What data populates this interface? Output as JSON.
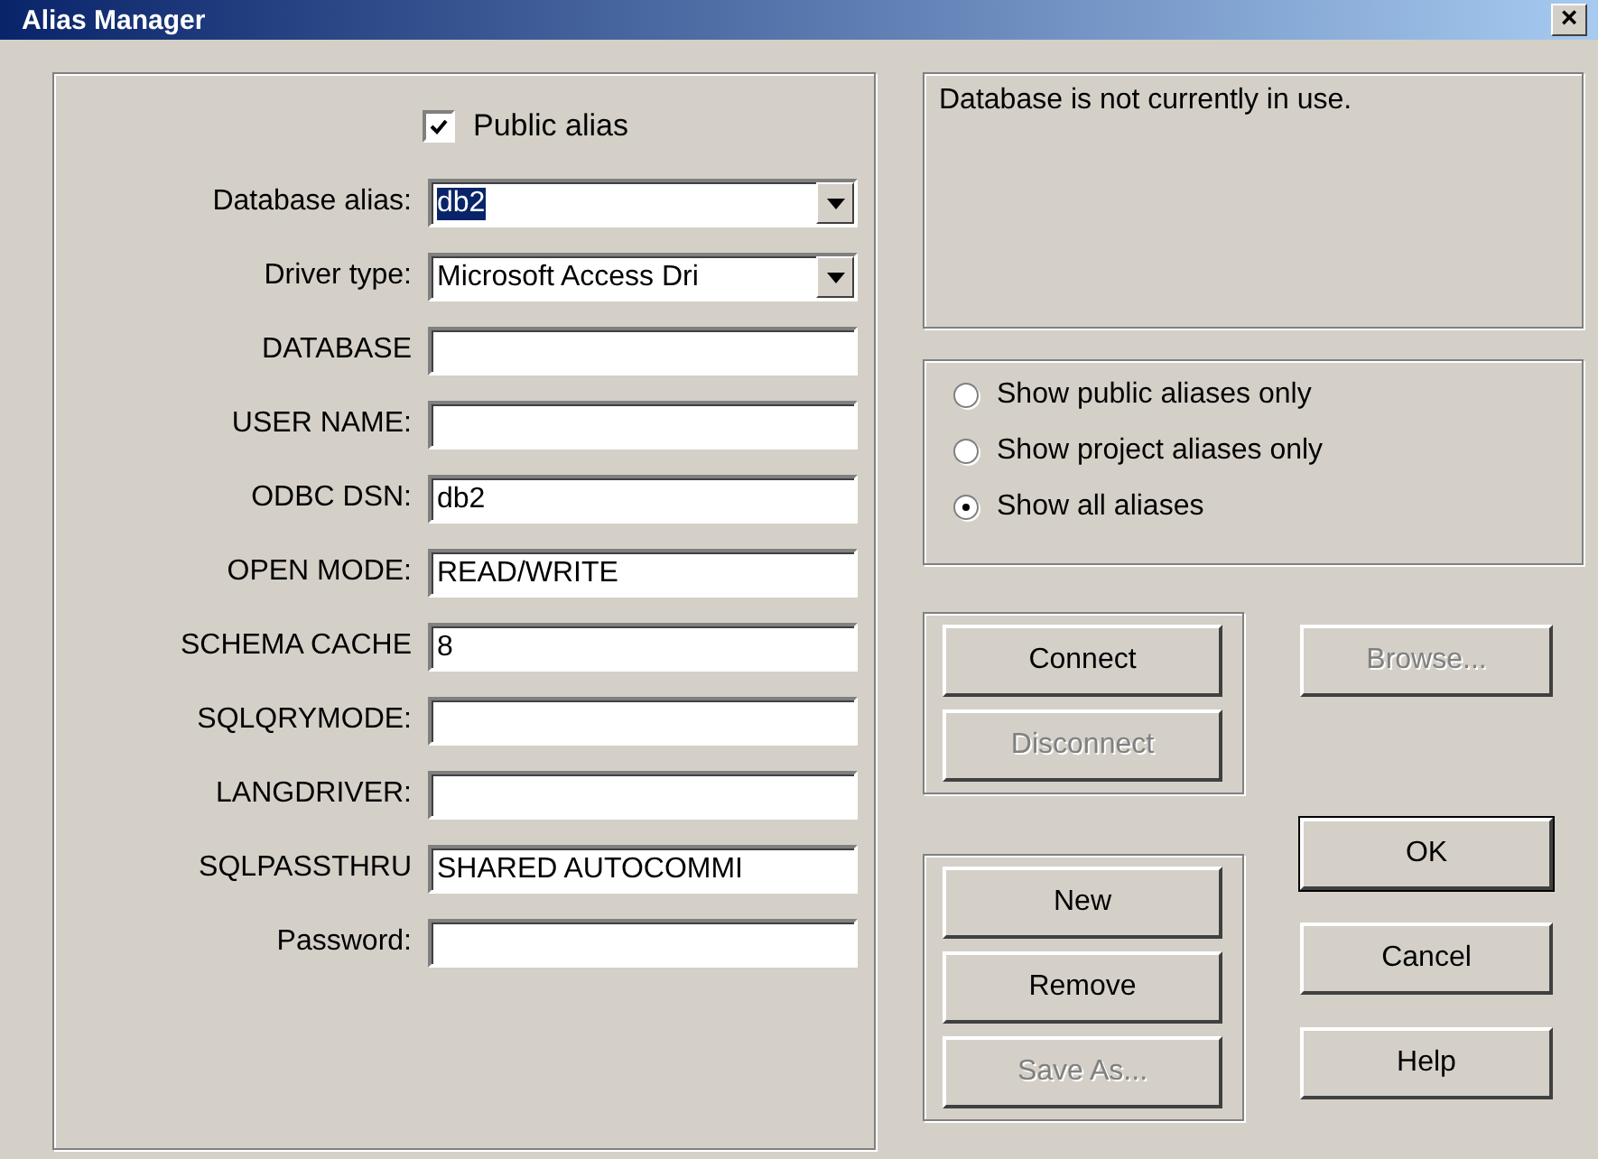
{
  "window": {
    "title": "Alias Manager",
    "close": "×"
  },
  "public_alias": {
    "label": "Public alias",
    "checked": true
  },
  "fields": [
    {
      "kind": "combo",
      "label": "Database alias:",
      "value": "db2",
      "highlighted": true
    },
    {
      "kind": "combo",
      "label": "Driver type:",
      "value": "Microsoft Access Dri",
      "highlighted": false
    },
    {
      "kind": "text",
      "label": "DATABASE"
    },
    {
      "kind": "text",
      "label": "USER NAME:"
    },
    {
      "kind": "text",
      "label": "ODBC DSN:",
      "value": "db2"
    },
    {
      "kind": "text",
      "label": "OPEN MODE:",
      "value": "READ/WRITE"
    },
    {
      "kind": "text",
      "label": "SCHEMA CACHE",
      "value": "8"
    },
    {
      "kind": "text",
      "label": "SQLQRYMODE:"
    },
    {
      "kind": "text",
      "label": "LANGDRIVER:"
    },
    {
      "kind": "text",
      "label": "SQLPASSTHRU",
      "value": "SHARED AUTOCOMMI"
    },
    {
      "kind": "text",
      "label": "Password:"
    }
  ],
  "status": "Database is not currently in use.",
  "filter": [
    {
      "label": "Show public aliases only",
      "selected": false
    },
    {
      "label": "Show project aliases only",
      "selected": false
    },
    {
      "label": "Show all aliases",
      "selected": true
    }
  ],
  "connection_buttons": [
    {
      "label": "Connect",
      "disabled": false
    },
    {
      "label": "Disconnect",
      "disabled": true
    }
  ],
  "browse_button": {
    "label": "Browse...",
    "disabled": true
  },
  "alias_buttons": [
    {
      "label": "New",
      "disabled": false
    },
    {
      "label": "Remove",
      "disabled": false
    },
    {
      "label": "Save As...",
      "disabled": true
    }
  ],
  "dialog_buttons": [
    {
      "label": "OK",
      "default": true
    },
    {
      "label": "Cancel",
      "default": false
    },
    {
      "label": "Help",
      "default": false
    }
  ]
}
